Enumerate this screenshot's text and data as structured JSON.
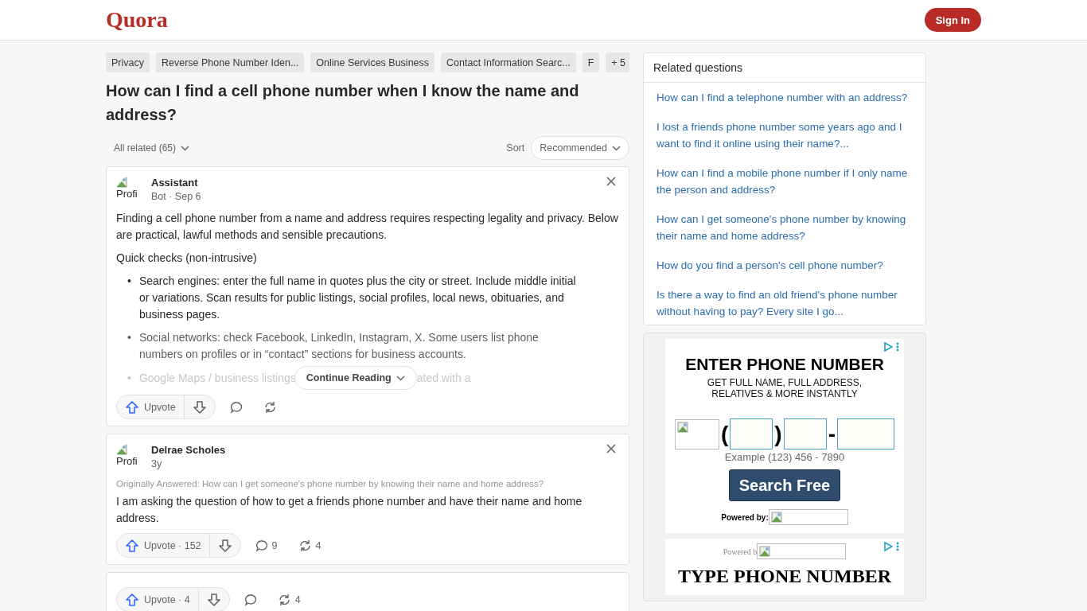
{
  "header": {
    "logo": "Quora",
    "sign_in": "Sign In"
  },
  "topics": [
    "Privacy",
    "Reverse Phone Number Iden...",
    "Online Services Business",
    "Contact Information Searc...",
    "F",
    "+ 5"
  ],
  "question": "How can I find a cell phone number when I know the name and address?",
  "filter": {
    "all_related": "All related (65)",
    "sort_label": "Sort",
    "sort_value": "Recommended"
  },
  "answers": [
    {
      "avatar_alt": "Profi",
      "author": "Assistant",
      "meta": "Bot · Sep 6",
      "paragraphs": [
        "Finding a cell phone number from a name and address requires respecting legality and privacy. Below are practical, lawful methods and sensible precautions.",
        "Quick checks (non-intrusive)"
      ],
      "bullets": [
        "Search engines: enter the full name in quotes plus the city or street. Include middle initial or variations. Scan results for public listings, social profiles, local news, obituaries, and business pages.",
        "Social networks: check Facebook, LinkedIn, Instagram, X. Some users list phone numbers on profiles or in “contact” sections for business accounts."
      ],
      "marker": "•",
      "faded_bullet": {
        "before": "Google Maps / business listings",
        "after": "ated with a"
      },
      "continue": "Continue Reading",
      "upvote": "Upvote"
    },
    {
      "avatar_alt": "Profi",
      "author": "Delrae Scholes",
      "meta": "3y",
      "originally": "Originally Answered: How can I get someone's phone number by knowing their name and home address?",
      "paragraphs": [
        "I am asking the question of how to get a friends phone number and have their name and home address."
      ],
      "upvote": "Upvote · 152",
      "comments": "9",
      "shares": "4"
    },
    {
      "upvote": "Upvote · 4",
      "shares": "4"
    }
  ],
  "related": {
    "title": "Related questions",
    "items": [
      "How can I find a telephone number with an address?",
      "I lost a friends phone number some years ago and I want to find it online using their name?...",
      "How can I find a mobile phone number if I only name the person and address?",
      "How can I get someone's phone number by knowing their name and home address?",
      "How do you find a person's cell phone number?",
      "Is there a way to find an old friend's phone number without having to pay? Every site I go..."
    ]
  },
  "ads": [
    {
      "kind": "form",
      "headline": "ENTER PHONE NUMBER",
      "sub": [
        "GET FULL NAME, FULL ADDRESS,",
        "RELATIVES & MORE INSTANTLY"
      ],
      "open_paren": "(",
      "close_paren": ")",
      "dash": "-",
      "example": "Example (123) 456 - 7890",
      "button": "Search Free",
      "powered": "Powered by:"
    },
    {
      "kind": "banner",
      "powered": "Powered b",
      "headline": "TYPE PHONE NUMBER"
    }
  ]
}
